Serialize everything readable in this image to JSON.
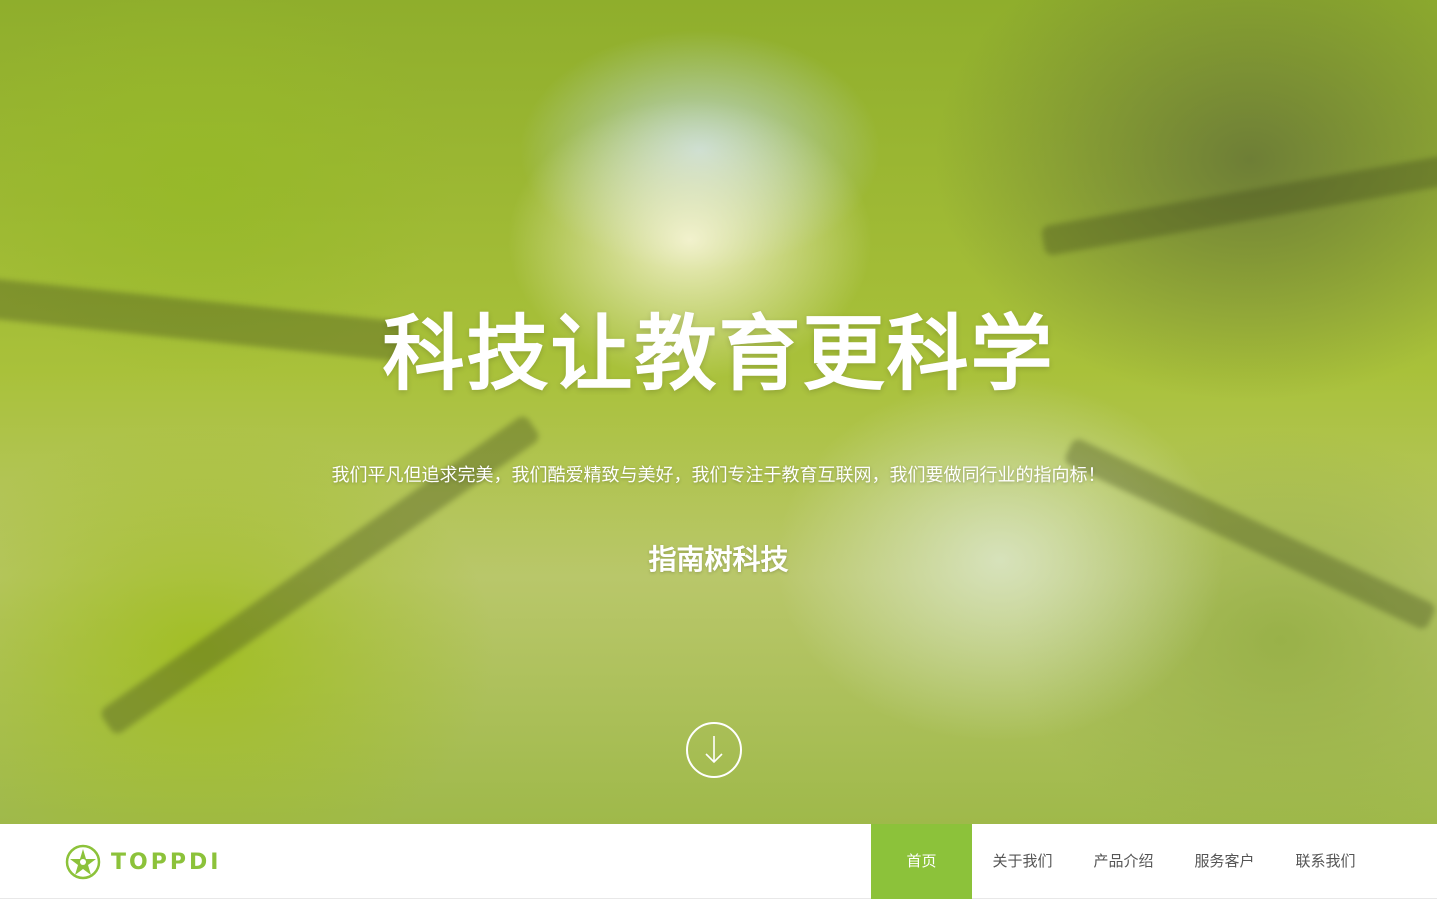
{
  "hero": {
    "title": "科技让教育更科学",
    "subtitle": "我们平凡但追求完美，我们酷爱精致与美好，我们专注于教育互联网，我们要做同行业的指向标！",
    "brand": "指南树科技",
    "scroll_icon": "arrow-down-circle-icon"
  },
  "header": {
    "logo_text": "TOPPDI",
    "logo_icon": "leaf-star-icon",
    "nav": [
      {
        "label": "首页",
        "active": true
      },
      {
        "label": "关于我们",
        "active": false
      },
      {
        "label": "产品介绍",
        "active": false
      },
      {
        "label": "服务客户",
        "active": false
      },
      {
        "label": "联系我们",
        "active": false
      }
    ]
  },
  "colors": {
    "accent": "#8cc23a",
    "nav_text": "#555555",
    "hero_text": "#ffffff"
  }
}
